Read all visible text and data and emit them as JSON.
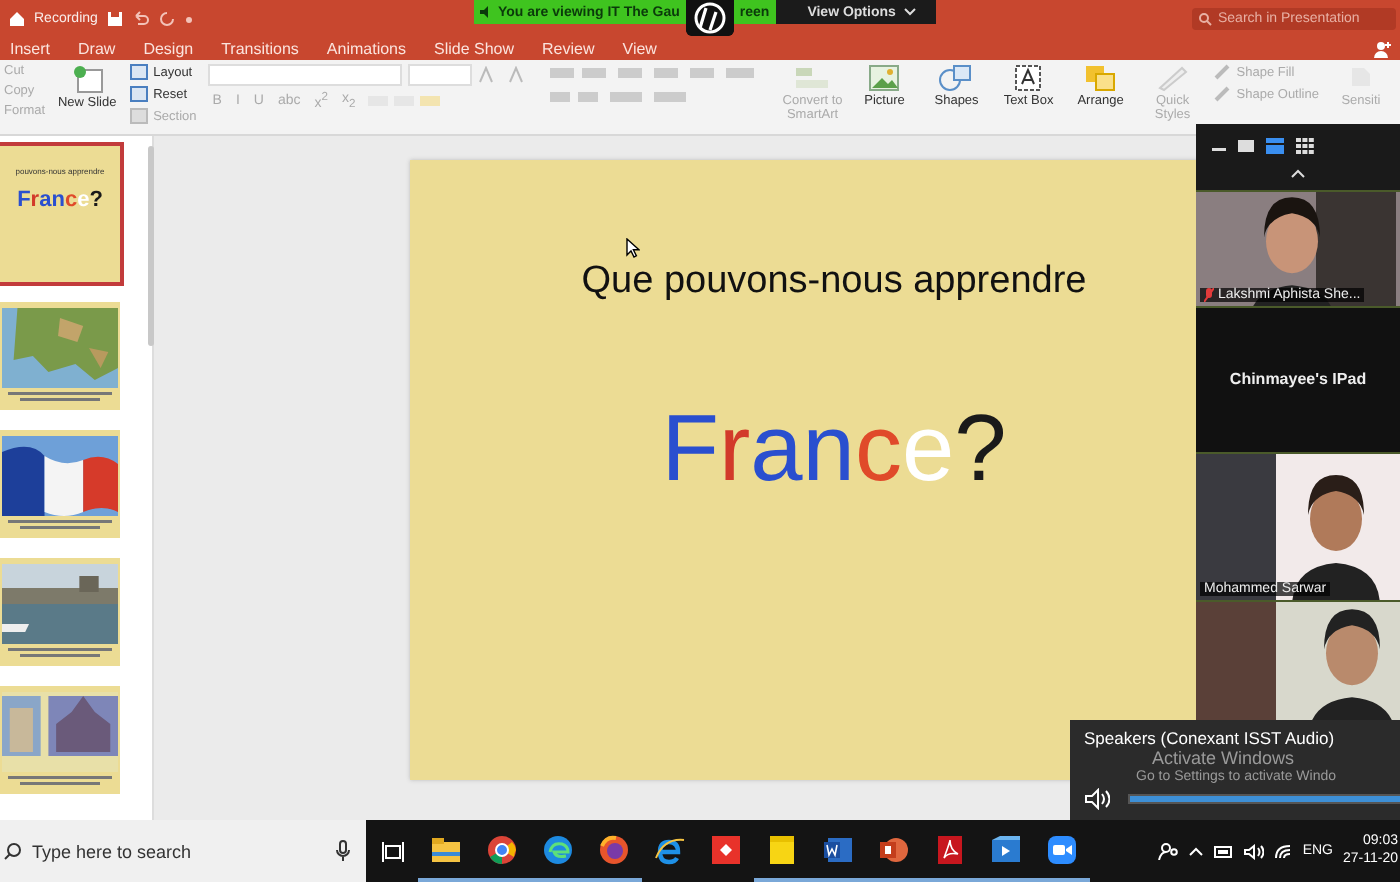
{
  "titlebar": {
    "file_title": "Recording",
    "search": {
      "placeholder": "Search in Presentation"
    },
    "tabs": [
      {
        "label": "Insert"
      },
      {
        "label": "Draw"
      },
      {
        "label": "Design"
      },
      {
        "label": "Transitions"
      },
      {
        "label": "Animations"
      },
      {
        "label": "Slide Show"
      },
      {
        "label": "Review"
      },
      {
        "label": "View"
      }
    ]
  },
  "share_banner": {
    "text": "You are viewing IT The Gau",
    "text_after": "reen",
    "view_options": "View Options"
  },
  "ribbon": {
    "clipboard": [
      {
        "label": "Cut",
        "disabled": true
      },
      {
        "label": "Copy",
        "disabled": true
      },
      {
        "label": "Format",
        "disabled": true
      }
    ],
    "new_slide": "New Slide",
    "slide_actions": [
      {
        "label": "Layout",
        "disabled": false
      },
      {
        "label": "Reset",
        "disabled": false
      },
      {
        "label": "Section",
        "disabled": true
      }
    ],
    "format_buttons": [
      {
        "label": "B",
        "disabled": true
      },
      {
        "label": "I",
        "disabled": true
      },
      {
        "label": "U",
        "disabled": true
      },
      {
        "label": "abc",
        "disabled": true
      },
      {
        "label": "x$^{2}$",
        "disabled": true
      },
      {
        "label": "x$_{2}$",
        "disabled": true
      }
    ],
    "insert_buttons": [
      {
        "kind": "smartart",
        "label": "Convert to SmartArt",
        "disabled": true
      },
      {
        "kind": "picture",
        "label": "Picture",
        "disabled": false
      },
      {
        "kind": "shapes",
        "label": "Shapes",
        "disabled": false
      },
      {
        "kind": "textbox",
        "label": "Text Box",
        "disabled": false
      },
      {
        "kind": "arrange",
        "label": "Arrange",
        "disabled": false
      },
      {
        "kind": "styles",
        "label": "Quick Styles",
        "disabled": true
      }
    ],
    "shape_options": [
      {
        "label": "Shape Fill",
        "disabled": true
      },
      {
        "label": "Shape Outline",
        "disabled": true
      }
    ],
    "sensitivity": "Sensiti"
  },
  "thumbnails": [
    {
      "kind": "title",
      "selected": true,
      "title": "pouvons-nous apprendre",
      "letters": [
        {
          "text": "F",
          "color": "#2a4fcf"
        },
        {
          "text": "r",
          "color": "#d23a2a"
        },
        {
          "text": "a",
          "color": "#2a4fcf"
        },
        {
          "text": "n",
          "color": "#2a4fcf"
        },
        {
          "text": "c",
          "color": "#e04a2a"
        },
        {
          "text": "e",
          "color": "#ffffff"
        },
        {
          "text": "?",
          "color": "#1a1a1a"
        }
      ]
    },
    {
      "kind": "map",
      "selected": false
    },
    {
      "kind": "flag",
      "selected": false
    },
    {
      "kind": "river",
      "selected": false
    },
    {
      "kind": "monuments",
      "selected": false
    }
  ],
  "slide": {
    "title": "Que pouvons-nous apprendre",
    "letters": [
      {
        "text": "F",
        "color": "#2a4fcf"
      },
      {
        "text": "r",
        "color": "#d23a2a"
      },
      {
        "text": "a",
        "color": "#2a4fcf"
      },
      {
        "text": "n",
        "color": "#2a4fcf"
      },
      {
        "text": "c",
        "color": "#e04a2a"
      },
      {
        "text": "e",
        "color": "#ffffff"
      },
      {
        "text": "?",
        "color": "#1a1a1a"
      }
    ]
  },
  "meeting": {
    "views": [
      {
        "kind": "speaker",
        "selected": true
      },
      {
        "kind": "gallery",
        "selected": false
      }
    ],
    "tiles": [
      {
        "kind": "video",
        "name": "Lakshmi Aphista She...",
        "muted": true
      },
      {
        "kind": "name",
        "name": "Chinmayee's IPad"
      },
      {
        "kind": "video",
        "name": "Mohammed Sarwar",
        "muted": false
      },
      {
        "kind": "video"
      }
    ]
  },
  "volume": {
    "device": "Speakers (Conexant ISST Audio)",
    "level": 1,
    "notice_title": "Activate Windows",
    "notice_text": "Go to Settings to activate Windo"
  },
  "taskbar": {
    "search": {
      "placeholder": "Type here to search"
    },
    "apps": [
      {
        "kind": "explorer",
        "running": true
      },
      {
        "kind": "chrome",
        "running": true
      },
      {
        "kind": "edge",
        "running": true
      },
      {
        "kind": "firefox",
        "running": true
      },
      {
        "kind": "ie",
        "running": false
      },
      {
        "kind": "remote",
        "running": false
      },
      {
        "kind": "notes",
        "running": true
      },
      {
        "kind": "word",
        "running": true
      },
      {
        "kind": "powerpoint",
        "running": true
      },
      {
        "kind": "acrobat",
        "running": true
      },
      {
        "kind": "player",
        "running": true
      },
      {
        "kind": "zoom",
        "running": true
      }
    ],
    "language": "ENG",
    "time": "09:03",
    "date": "27-11-20"
  }
}
